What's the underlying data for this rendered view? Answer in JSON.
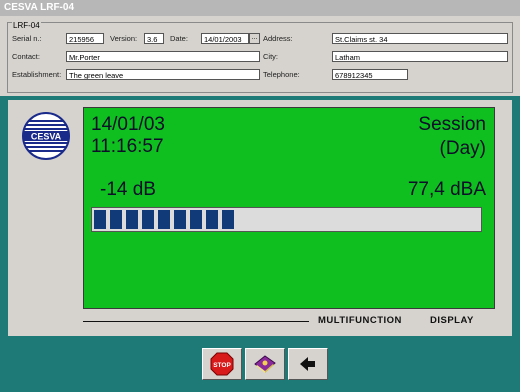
{
  "window": {
    "title": "CESVA LRF-04"
  },
  "form": {
    "group_label": "LRF-04",
    "serial_label": "Serial n.:",
    "serial": "215956",
    "version_label": "Version:",
    "version": "3.6",
    "date_label": "Date:",
    "date": "14/01/2003",
    "date_button": "...",
    "address_label": "Address:",
    "address": "St.Claims st. 34",
    "contact_label": "Contact:",
    "contact": "Mr.Porter",
    "city_label": "City:",
    "city": "Latham",
    "establishment_label": "Establishment:",
    "establishment": "The green leave",
    "telephone_label": "Telephone:",
    "telephone": "678912345"
  },
  "display": {
    "logo_text": "CESVA",
    "date": "14/01/03",
    "time": "11:16:57",
    "session_line1": "Session",
    "session_line2": "(Day)",
    "db_left": "-14 dB",
    "level": "77,4 dBA",
    "bar_segments": 9,
    "caption_multifunction": "MULTIFUNCTION",
    "caption_display": "DISPLAY"
  },
  "toolbar": {
    "stop_label": "STOP"
  },
  "colors": {
    "screen": "#0fbf1f",
    "bar_fill": "#103a78",
    "background": "#1d7a76"
  }
}
